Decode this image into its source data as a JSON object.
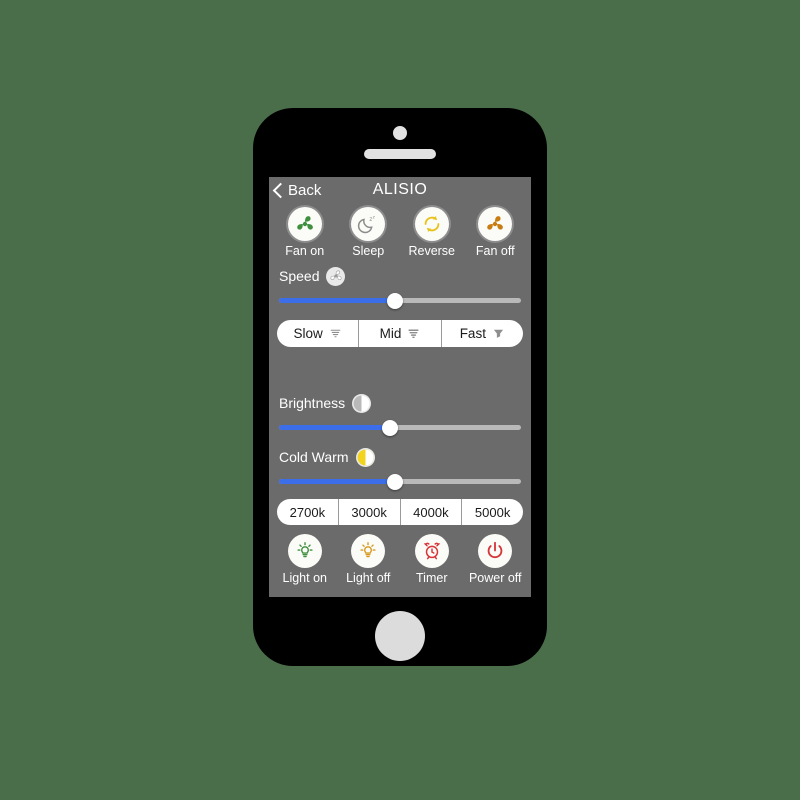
{
  "app": {
    "background_color": "#4a6e4a",
    "screen_color": "#6b6b6b",
    "accent_color": "#3b6ee8"
  },
  "navbar": {
    "back_label": "Back",
    "title": "ALISIO"
  },
  "fan_controls": [
    {
      "label": "Fan on",
      "icon": "fan-icon",
      "color": "#3f8f3f"
    },
    {
      "label": "Sleep",
      "icon": "moon-zzz-icon",
      "color": "#8c8c8c"
    },
    {
      "label": "Reverse",
      "icon": "circular-arrows-icon",
      "color": "#e8c21a"
    },
    {
      "label": "Fan off",
      "icon": "fan-icon",
      "color": "#c87d12"
    }
  ],
  "speed": {
    "label": "Speed",
    "icon": "fan-small-icon",
    "slider_value": 48,
    "options": [
      {
        "label": "Slow",
        "icon": "tornado-light-icon"
      },
      {
        "label": "Mid",
        "icon": "tornado-medium-icon"
      },
      {
        "label": "Fast",
        "icon": "tornado-solid-icon"
      }
    ]
  },
  "brightness": {
    "label": "Brightness",
    "icon": "half-circle-white-icon",
    "slider_value": 46
  },
  "cold_warm": {
    "label": "Cold Warm",
    "icon": "half-circle-yellow-icon",
    "slider_value": 48
  },
  "color_temperatures": [
    {
      "label": "2700k"
    },
    {
      "label": "3000k"
    },
    {
      "label": "4000k"
    },
    {
      "label": "5000k"
    }
  ],
  "light_controls": [
    {
      "label": "Light on",
      "icon": "bulb-icon",
      "color": "#3f8f3f"
    },
    {
      "label": "Light off",
      "icon": "bulb-icon",
      "color": "#d79b22"
    },
    {
      "label": "Timer",
      "icon": "alarm-clock-icon",
      "color": "#d6353a"
    },
    {
      "label": "Power off",
      "icon": "power-icon",
      "color": "#d6353a"
    }
  ]
}
